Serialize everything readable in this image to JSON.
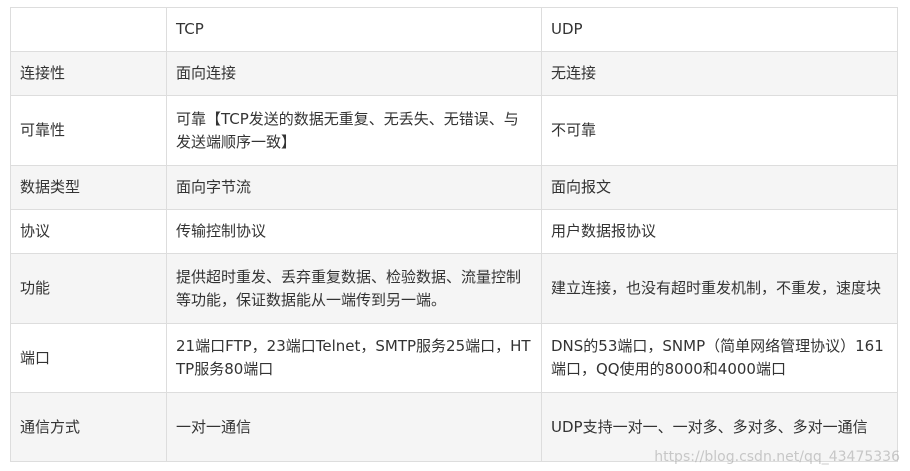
{
  "table": {
    "header": [
      "",
      "TCP",
      "UDP"
    ],
    "rows": [
      [
        "连接性",
        "面向连接",
        "无连接"
      ],
      [
        "可靠性",
        "可靠【TCP发送的数据无重复、无丢失、无错误、与发送端顺序一致】",
        "不可靠"
      ],
      [
        "数据类型",
        "面向字节流",
        "面向报文"
      ],
      [
        "协议",
        "传输控制协议",
        "用户数据报协议"
      ],
      [
        "功能",
        "提供超时重发、丢弃重复数据、检验数据、流量控制等功能，保证数据能从一端传到另一端。",
        "建立连接，也没有超时重发机制，不重发，速度块"
      ],
      [
        "端口",
        "21端口FTP，23端口Telnet，SMTP服务25端口，HTTP服务80端口",
        "DNS的53端口，SNMP（简单网络管理协议）161端口，QQ使用的8000和4000端口"
      ],
      [
        "通信方式",
        "一对一通信",
        "UDP支持一对一、一对多、多对多、多对一通信"
      ]
    ]
  },
  "watermark": "https://blog.csdn.net/qq_43475336"
}
